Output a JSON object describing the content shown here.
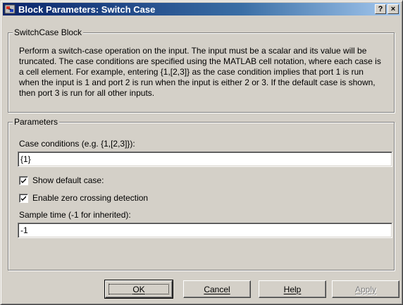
{
  "window": {
    "title": "Block Parameters: Switch Case",
    "help_button": "?",
    "close_button": "×"
  },
  "block_group": {
    "legend": "SwitchCase Block",
    "description": "Perform a switch-case operation on the input.  The input must be a scalar and its value will be truncated.  The case conditions are specified using the MATLAB cell notation, where each case is a cell element.  For example, entering {1,[2,3]} as the case condition implies that port 1 is run when the input is 1 and port 2 is run when the input is either 2 or 3.  If the default case is shown, then port 3 is run for all other inputs."
  },
  "parameters_group": {
    "legend": "Parameters",
    "case_conditions_label": "Case conditions (e.g. {1,[2,3]}):",
    "case_conditions_value": "{1}",
    "show_default_case_label": "Show default case:",
    "show_default_case_checked": true,
    "zero_crossing_label": "Enable zero crossing detection",
    "zero_crossing_checked": true,
    "sample_time_label": "Sample time (-1 for inherited):",
    "sample_time_value": "-1"
  },
  "buttons": {
    "ok": "OK",
    "cancel": "Cancel",
    "help": "Help",
    "apply": "Apply"
  },
  "icons": {
    "app_icon": "simulink-block-icon",
    "check": "checkmark-icon"
  }
}
